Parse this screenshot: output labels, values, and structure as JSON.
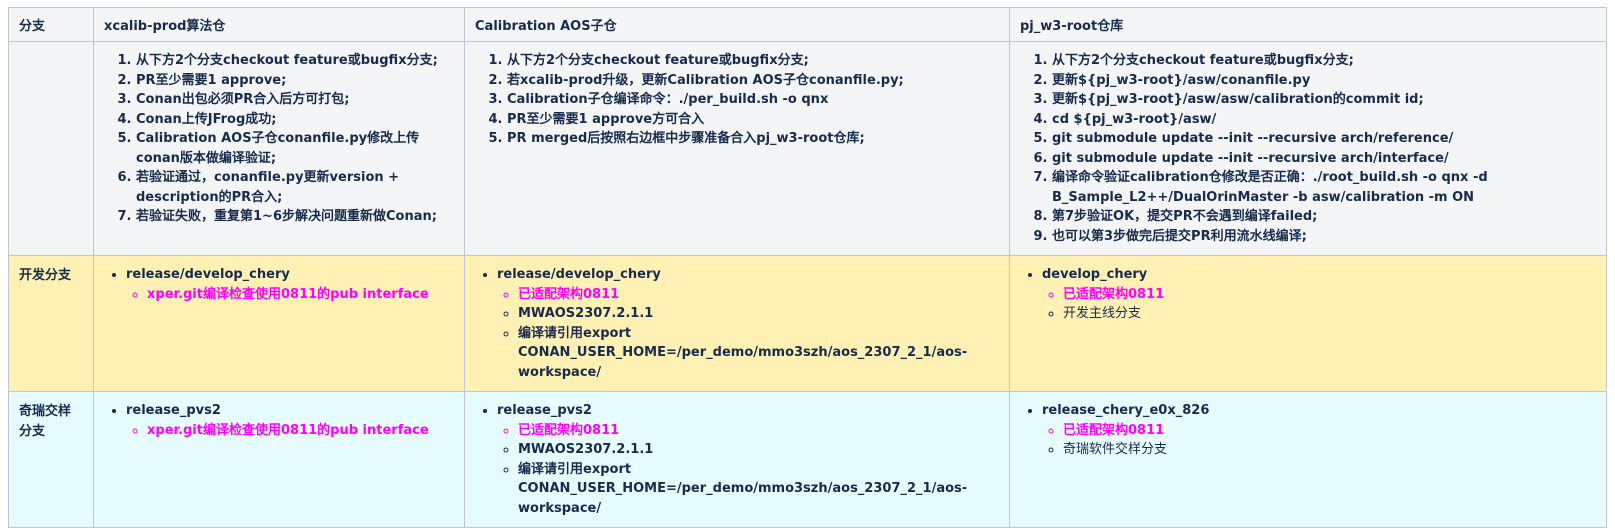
{
  "headers": [
    "分支",
    "xcalib-prod算法仓",
    "Calibration AOS子仓",
    "pj_w3-root仓库"
  ],
  "steps": {
    "col1": [
      "从下方2个分支checkout feature或bugfix分支;",
      "PR至少需要1 approve;",
      "Conan出包必须PR合入后方可打包;",
      "Conan上传JFrog成功;",
      "Calibration AOS子仓conanfile.py修改上传conan版本做编译验证;",
      "若验证通过，conanfile.py更新version + description的PR合入;",
      "若验证失败，重复第1~6步解决问题重新做Conan;"
    ],
    "col2": [
      "从下方2个分支checkout feature或bugfix分支;",
      "若xcalib-prod升级，更新Calibration AOS子仓conanfile.py;",
      "Calibration子仓编译命令：./per_build.sh -o qnx",
      "PR至少需要1 approve方可合入",
      "PR merged后按照右边框中步骤准备合入pj_w3-root仓库;"
    ],
    "col3": [
      "从下方2个分支checkout feature或bugfix分支;",
      "更新${pj_w3-root}/asw/conanfile.py",
      "更新${pj_w3-root}/asw/asw/calibration的commit id;",
      "cd ${pj_w3-root}/asw/",
      "git submodule update --init --recursive arch/reference/",
      "git submodule update --init --recursive arch/interface/",
      "编译命令验证calibration仓修改是否正确：./root_build.sh -o qnx -d B_Sample_L2++/DualOrinMaster -b asw/calibration -m ON",
      "第7步验证OK，提交PR不会遇到编译failed;",
      "也可以第3步做完后提交PR利用流水线编译;"
    ]
  },
  "dev": {
    "label": "开发分支",
    "col1": {
      "branch": "release/develop_chery",
      "note": "xper.git编译检查使用0811的pub interface"
    },
    "col2": {
      "branch": "release/develop_chery",
      "arch": "已适配架构0811",
      "version": "MWAOS2307.2.1.1",
      "build": "编译请引用export CONAN_USER_HOME=/per_demo/mmo3szh/aos_2307_2_1/aos-workspace/"
    },
    "col3": {
      "branch": "develop_chery",
      "arch": "已适配架构0811",
      "desc": "开发主线分支"
    }
  },
  "chery": {
    "label": "奇瑞交样分支",
    "col1": {
      "branch": "release_pvs2",
      "note": "xper.git编译检查使用0811的pub interface"
    },
    "col2": {
      "branch": "release_pvs2",
      "arch": "已适配架构0811",
      "version": "MWAOS2307.2.1.1",
      "build": "编译请引用export CONAN_USER_HOME=/per_demo/mmo3szh/aos_2307_2_1/aos-workspace/"
    },
    "col3": {
      "branch": "release_chery_e0x_826",
      "arch": "已适配架构0811",
      "desc": "奇瑞软件交样分支"
    }
  }
}
